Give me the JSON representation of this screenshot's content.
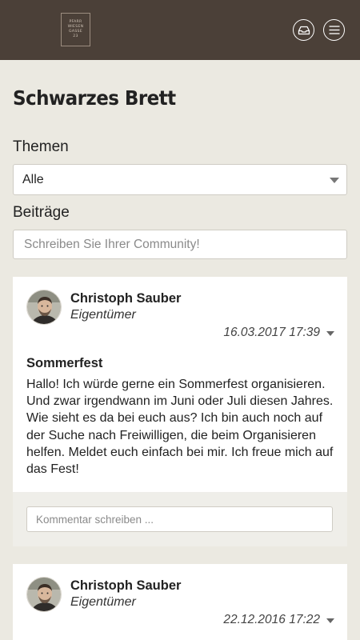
{
  "header": {
    "logo_lines": [
      "PFARR",
      "WIESEN",
      "GASSE",
      "23"
    ],
    "inbox_icon": "inbox-icon",
    "menu_icon": "hamburger-menu-icon"
  },
  "page": {
    "title": "Schwarzes Brett"
  },
  "filters": {
    "topics_label": "Themen",
    "topics_selected": "Alle",
    "posts_label": "Beiträge",
    "post_placeholder": "Schreiben Sie Ihrer Community!"
  },
  "posts": [
    {
      "author": "Christoph Sauber",
      "role": "Eigentümer",
      "date": "16.03.2017 17:39",
      "title": "Sommerfest",
      "body": "Hallo! Ich würde gerne ein Sommerfest organisieren. Und zwar irgendwann im Juni oder Juli diesen Jahres. Wie sieht es da bei euch aus? Ich bin auch noch auf der Suche nach Freiwilligen, die beim Organisieren helfen. Meldet euch einfach bei mir. Ich freue mich auf das Fest!",
      "comment_placeholder": "Kommentar schreiben ..."
    },
    {
      "author": "Christoph Sauber",
      "role": "Eigentümer",
      "date": "22.12.2016 17:22"
    }
  ],
  "colors": {
    "header_bg": "#4b4038",
    "page_bg": "#ebe9e1",
    "card_bg": "#ffffff",
    "comment_bg": "#efeee9"
  }
}
